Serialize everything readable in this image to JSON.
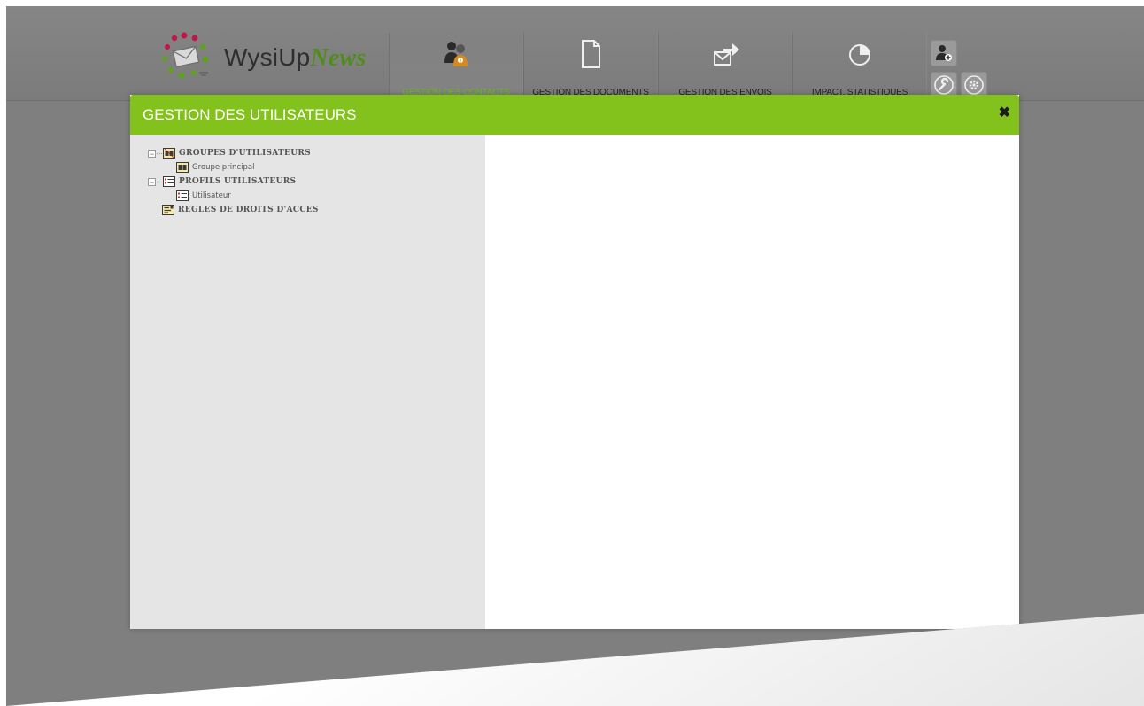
{
  "app": {
    "logo_wysi": "WysiUp",
    "logo_news": "News"
  },
  "nav": [
    {
      "label": "GESTION DES CONTACTS",
      "icon": "contacts-icon",
      "active": true
    },
    {
      "label": "GESTION DES DOCUMENTS",
      "icon": "document-icon",
      "active": false
    },
    {
      "label": "GESTION DES ENVOIS",
      "icon": "send-mail-icon",
      "active": false
    },
    {
      "label": "IMPACT, STATISTIQUES",
      "icon": "pie-chart-icon",
      "active": false
    }
  ],
  "tools": [
    "user-add-icon",
    "wrench-icon",
    "gear-icon"
  ],
  "modal": {
    "title": "GESTION DES UTILISATEURS",
    "close": "✖"
  },
  "tree": {
    "groups_label": "GROUPES D'UTILISATEURS",
    "groups_child": "Groupe principal",
    "profiles_label": "PROFILS UTILISATEURS",
    "profiles_child": "Utilisateur",
    "rules_label": "REGLES DE DROITS D'ACCES"
  },
  "colors": {
    "accent": "#83c21d",
    "active_nav": "#6fb81f",
    "backdrop": "#7f7f7f",
    "left_panel": "#e5e5e5"
  }
}
